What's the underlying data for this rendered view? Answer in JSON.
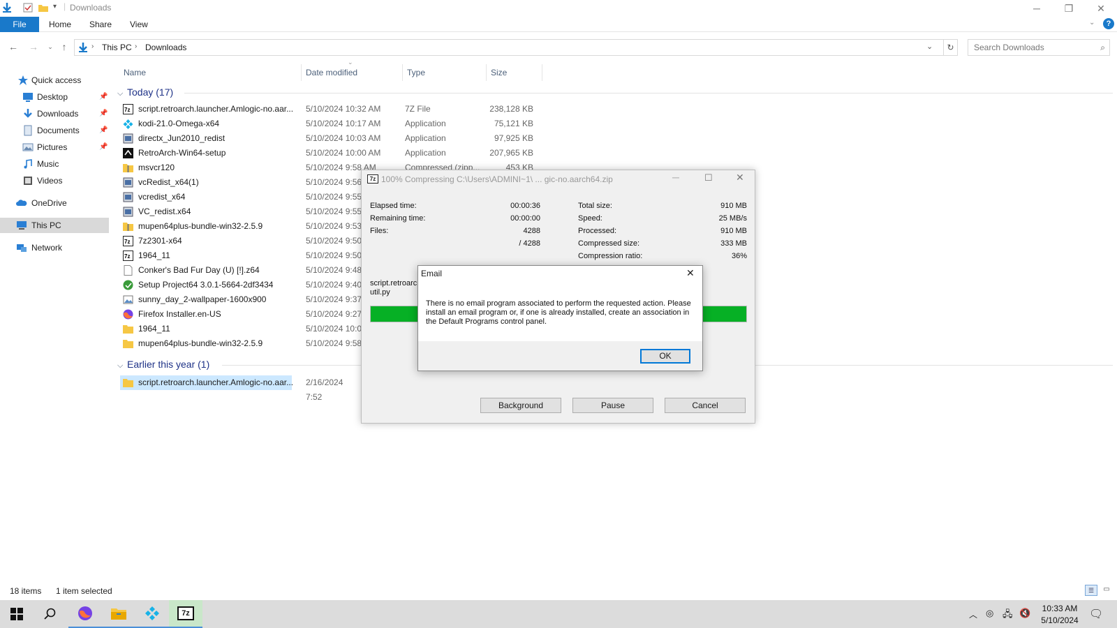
{
  "window": {
    "title": "Downloads"
  },
  "ribbon": {
    "tabs": [
      "File",
      "Home",
      "Share",
      "View"
    ]
  },
  "address": {
    "crumbs": [
      "This PC",
      "Downloads"
    ],
    "search_placeholder": "Search Downloads"
  },
  "nav": {
    "quick_access": "Quick access",
    "items": [
      {
        "label": "Desktop",
        "icon": "desktop-icon",
        "pinned": true
      },
      {
        "label": "Downloads",
        "icon": "downloads-icon",
        "pinned": true
      },
      {
        "label": "Documents",
        "icon": "documents-icon",
        "pinned": true
      },
      {
        "label": "Pictures",
        "icon": "pictures-icon",
        "pinned": true
      },
      {
        "label": "Music",
        "icon": "music-icon",
        "pinned": false
      },
      {
        "label": "Videos",
        "icon": "videos-icon",
        "pinned": false
      }
    ],
    "onedrive": "OneDrive",
    "this_pc": "This PC",
    "network": "Network"
  },
  "columns": {
    "name": "Name",
    "date": "Date modified",
    "type": "Type",
    "size": "Size"
  },
  "groups": {
    "today": "Today (17)",
    "earlier": "Earlier this year (1)"
  },
  "files_today": [
    {
      "name": "script.retroarch.launcher.Amlogic-no.aar...",
      "date": "5/10/2024 10:32 AM",
      "type": "7Z File",
      "size": "238,128 KB",
      "icon": "7z-file-icon"
    },
    {
      "name": "kodi-21.0-Omega-x64",
      "date": "5/10/2024 10:17 AM",
      "type": "Application",
      "size": "75,121 KB",
      "icon": "kodi-icon"
    },
    {
      "name": "directx_Jun2010_redist",
      "date": "5/10/2024 10:03 AM",
      "type": "Application",
      "size": "97,925 KB",
      "icon": "installer-icon"
    },
    {
      "name": "RetroArch-Win64-setup",
      "date": "5/10/2024 10:00 AM",
      "type": "Application",
      "size": "207,965 KB",
      "icon": "retroarch-icon"
    },
    {
      "name": "msvcr120",
      "date": "5/10/2024 9:58 AM",
      "type": "Compressed (zipp...",
      "size": "453 KB",
      "icon": "zip-folder-icon"
    },
    {
      "name": "vcRedist_x64(1)",
      "date": "5/10/2024 9:56",
      "type": "",
      "size": "",
      "icon": "installer-icon"
    },
    {
      "name": "vcredist_x64",
      "date": "5/10/2024 9:55",
      "type": "",
      "size": "",
      "icon": "installer-icon"
    },
    {
      "name": "VC_redist.x64",
      "date": "5/10/2024 9:55",
      "type": "",
      "size": "",
      "icon": "installer-icon"
    },
    {
      "name": "mupen64plus-bundle-win32-2.5.9",
      "date": "5/10/2024 9:53",
      "type": "",
      "size": "",
      "icon": "zip-folder-icon"
    },
    {
      "name": "7z2301-x64",
      "date": "5/10/2024 9:50",
      "type": "",
      "size": "",
      "icon": "7z-file-icon"
    },
    {
      "name": "1964_11",
      "date": "5/10/2024 9:50",
      "type": "",
      "size": "",
      "icon": "7z-file-icon"
    },
    {
      "name": "Conker's Bad Fur Day (U) [!].z64",
      "date": "5/10/2024 9:48",
      "type": "",
      "size": "",
      "icon": "blank-file-icon"
    },
    {
      "name": "Setup Project64 3.0.1-5664-2df3434",
      "date": "5/10/2024 9:40",
      "type": "",
      "size": "",
      "icon": "project64-icon"
    },
    {
      "name": "sunny_day_2-wallpaper-1600x900",
      "date": "5/10/2024 9:37",
      "type": "",
      "size": "",
      "icon": "image-file-icon"
    },
    {
      "name": "Firefox Installer.en-US",
      "date": "5/10/2024 9:27",
      "type": "",
      "size": "",
      "icon": "firefox-icon"
    },
    {
      "name": "1964_11",
      "date": "5/10/2024 10:04",
      "type": "",
      "size": "",
      "icon": "folder-icon"
    },
    {
      "name": "mupen64plus-bundle-win32-2.5.9",
      "date": "5/10/2024 9:58",
      "type": "",
      "size": "",
      "icon": "folder-icon"
    }
  ],
  "files_earlier": [
    {
      "name": "script.retroarch.launcher.Amlogic-no.aar...",
      "date": "2/16/2024 7:52",
      "type": "",
      "size": "",
      "icon": "folder-icon"
    }
  ],
  "status": {
    "items": "18 items",
    "selected": "1 item selected"
  },
  "zip_dialog": {
    "title": "100% Compressing C:\\Users\\ADMINI~1\\ ... gic-no.aarch64.zip",
    "left": [
      {
        "label": "Elapsed time:",
        "value": "00:00:36"
      },
      {
        "label": "Remaining time:",
        "value": "00:00:00"
      },
      {
        "label": "Files:",
        "value": "4288"
      },
      {
        "label": "",
        "value": "/ 4288"
      }
    ],
    "right": [
      {
        "label": "Total size:",
        "value": "910 MB"
      },
      {
        "label": "Speed:",
        "value": "25 MB/s"
      },
      {
        "label": "Processed:",
        "value": "910 MB"
      },
      {
        "label": "Compressed size:",
        "value": "333 MB"
      },
      {
        "label": "Compression ratio:",
        "value": "36%"
      }
    ],
    "current_file": [
      "script.retroarch",
      "util.py"
    ],
    "progress": 100,
    "progress_color": "#06b025",
    "buttons": {
      "background": "Background",
      "pause": "Pause",
      "cancel": "Cancel"
    }
  },
  "email_dialog": {
    "title": "Email",
    "message": "There is no email program associated to perform the requested action. Please install an email program or, if one is already installed, create an association in the Default Programs control panel.",
    "ok": "OK"
  },
  "taskbar": {
    "time": "10:33 AM",
    "date": "5/10/2024"
  }
}
